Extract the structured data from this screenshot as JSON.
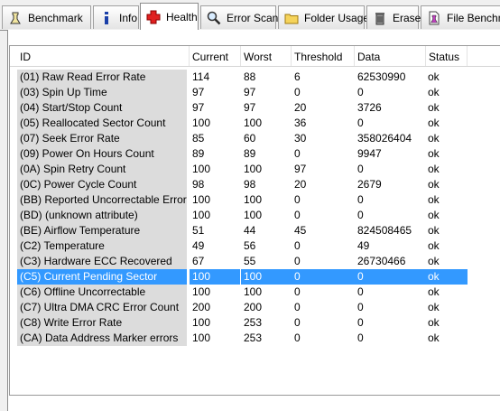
{
  "tabs": [
    {
      "label": "Benchmark",
      "icon": "benchmark-icon"
    },
    {
      "label": "Info",
      "icon": "info-icon"
    },
    {
      "label": "Health",
      "icon": "health-cross-icon"
    },
    {
      "label": "Error Scan",
      "icon": "magnifier-icon"
    },
    {
      "label": "Folder Usage",
      "icon": "folder-icon"
    },
    {
      "label": "Erase",
      "icon": "trash-icon"
    },
    {
      "label": "File Benchmark",
      "icon": "file-benchmark-icon"
    }
  ],
  "active_tab": "Health",
  "columns": [
    "ID",
    "Current",
    "Worst",
    "Threshold",
    "Data",
    "Status"
  ],
  "rows": [
    {
      "id": "(01) Raw Read Error Rate",
      "current": "114",
      "worst": "88",
      "threshold": "6",
      "data": "62530990",
      "status": "ok"
    },
    {
      "id": "(03) Spin Up Time",
      "current": "97",
      "worst": "97",
      "threshold": "0",
      "data": "0",
      "status": "ok"
    },
    {
      "id": "(04) Start/Stop Count",
      "current": "97",
      "worst": "97",
      "threshold": "20",
      "data": "3726",
      "status": "ok"
    },
    {
      "id": "(05) Reallocated Sector Count",
      "current": "100",
      "worst": "100",
      "threshold": "36",
      "data": "0",
      "status": "ok"
    },
    {
      "id": "(07) Seek Error Rate",
      "current": "85",
      "worst": "60",
      "threshold": "30",
      "data": "358026404",
      "status": "ok"
    },
    {
      "id": "(09) Power On Hours Count",
      "current": "89",
      "worst": "89",
      "threshold": "0",
      "data": "9947",
      "status": "ok"
    },
    {
      "id": "(0A) Spin Retry Count",
      "current": "100",
      "worst": "100",
      "threshold": "97",
      "data": "0",
      "status": "ok"
    },
    {
      "id": "(0C) Power Cycle Count",
      "current": "98",
      "worst": "98",
      "threshold": "20",
      "data": "2679",
      "status": "ok"
    },
    {
      "id": "(BB) Reported Uncorrectable Errors",
      "current": "100",
      "worst": "100",
      "threshold": "0",
      "data": "0",
      "status": "ok"
    },
    {
      "id": "(BD) (unknown attribute)",
      "current": "100",
      "worst": "100",
      "threshold": "0",
      "data": "0",
      "status": "ok"
    },
    {
      "id": "(BE) Airflow Temperature",
      "current": "51",
      "worst": "44",
      "threshold": "45",
      "data": "824508465",
      "status": "ok"
    },
    {
      "id": "(C2) Temperature",
      "current": "49",
      "worst": "56",
      "threshold": "0",
      "data": "49",
      "status": "ok"
    },
    {
      "id": "(C3) Hardware ECC Recovered",
      "current": "67",
      "worst": "55",
      "threshold": "0",
      "data": "26730466",
      "status": "ok"
    },
    {
      "id": "(C5) Current Pending Sector",
      "current": "100",
      "worst": "100",
      "threshold": "0",
      "data": "0",
      "status": "ok"
    },
    {
      "id": "(C6) Offline Uncorrectable",
      "current": "100",
      "worst": "100",
      "threshold": "0",
      "data": "0",
      "status": "ok"
    },
    {
      "id": "(C7) Ultra DMA CRC Error Count",
      "current": "200",
      "worst": "200",
      "threshold": "0",
      "data": "0",
      "status": "ok"
    },
    {
      "id": "(C8) Write Error Rate",
      "current": "100",
      "worst": "253",
      "threshold": "0",
      "data": "0",
      "status": "ok"
    },
    {
      "id": "(CA) Data Address Marker errors",
      "current": "100",
      "worst": "253",
      "threshold": "0",
      "data": "0",
      "status": "ok"
    }
  ],
  "selected_row": "(C5) Current Pending Sector",
  "colors": {
    "selection": "#3399ff",
    "id_column": "#dcdcdc",
    "health_icon": "#e02020"
  }
}
